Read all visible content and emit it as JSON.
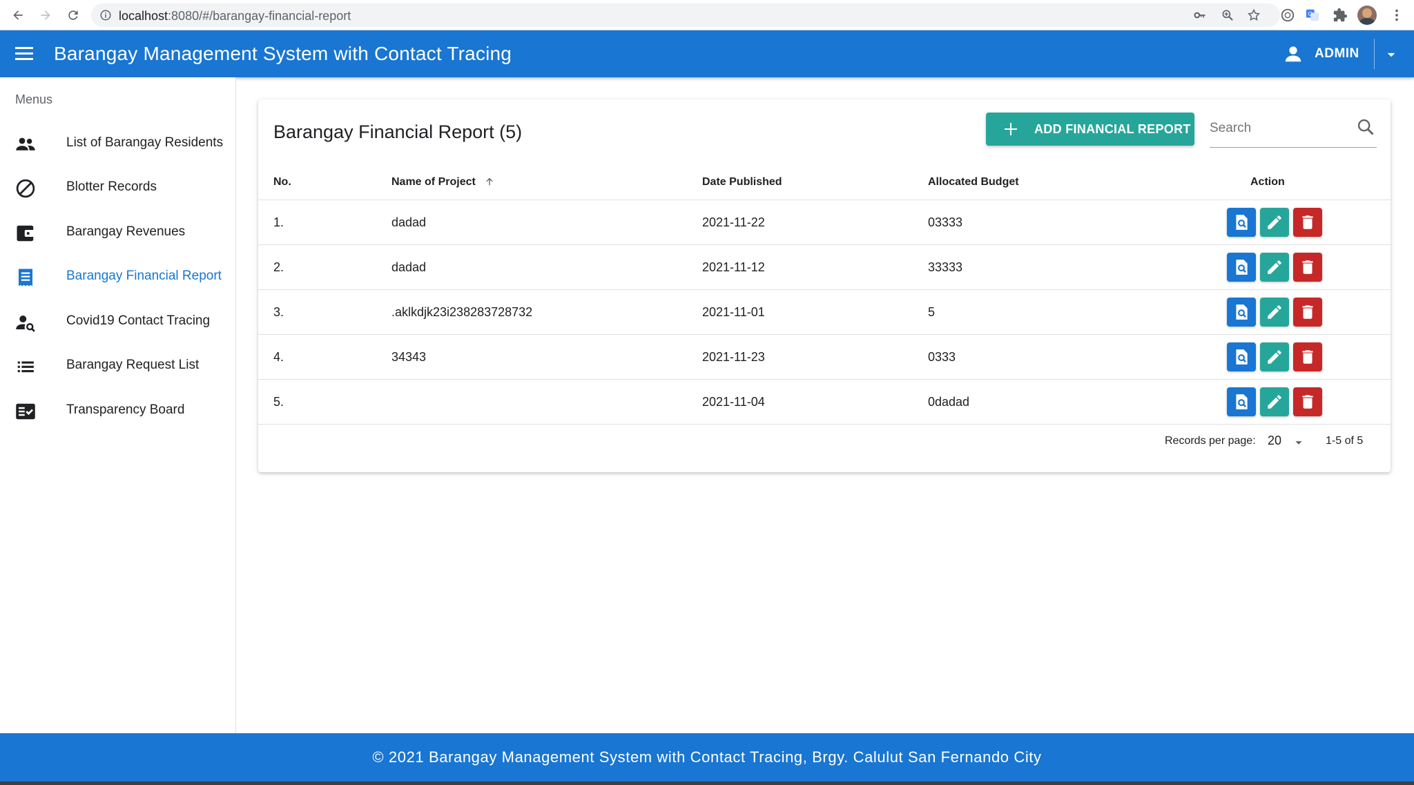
{
  "browser": {
    "url_host": "localhost",
    "url_rest": ":8080/#/barangay-financial-report"
  },
  "app": {
    "title": "Barangay Management System with Contact Tracing",
    "user_label": "ADMIN"
  },
  "sidebar": {
    "header": "Menus",
    "items": [
      {
        "label": "List of Barangay Residents",
        "icon": "people-icon",
        "active": false
      },
      {
        "label": "Blotter Records",
        "icon": "block-icon",
        "active": false
      },
      {
        "label": "Barangay Revenues",
        "icon": "wallet-icon",
        "active": false
      },
      {
        "label": "Barangay Financial Report",
        "icon": "receipt-icon",
        "active": true
      },
      {
        "label": "Covid19 Contact Tracing",
        "icon": "person-search-icon",
        "active": false
      },
      {
        "label": "Barangay Request List",
        "icon": "list-icon",
        "active": false
      },
      {
        "label": "Transparency Board",
        "icon": "fact-check-icon",
        "active": false
      }
    ]
  },
  "report": {
    "title": "Barangay Financial Report (5)",
    "add_button_label": "ADD FINANCIAL REPORT",
    "search_placeholder": "Search",
    "columns": {
      "no": "No.",
      "name": "Name of Project",
      "date": "Date Published",
      "budget": "Allocated Budget",
      "action": "Action"
    },
    "rows": [
      {
        "no": "1.",
        "name": "dadad",
        "date": "2021-11-22",
        "budget": "03333"
      },
      {
        "no": "2.",
        "name": "dadad",
        "date": "2021-11-12",
        "budget": "33333"
      },
      {
        "no": "3.",
        "name": ".aklkdjk23i238283728732",
        "date": "2021-11-01",
        "budget": "5"
      },
      {
        "no": "4.",
        "name": "34343",
        "date": "2021-11-23",
        "budget": "0333"
      },
      {
        "no": "5.",
        "name": "",
        "date": "2021-11-04",
        "budget": "0dadad"
      }
    ],
    "pagination": {
      "label": "Records per page:",
      "per_page": "20",
      "range": "1-5 of 5"
    }
  },
  "footer": {
    "text": "© 2021 Barangay Management System with Contact Tracing, Brgy. Calulut San Fernando City"
  },
  "colors": {
    "primary": "#1976d2",
    "teal": "#26a69a",
    "danger": "#c62828"
  }
}
